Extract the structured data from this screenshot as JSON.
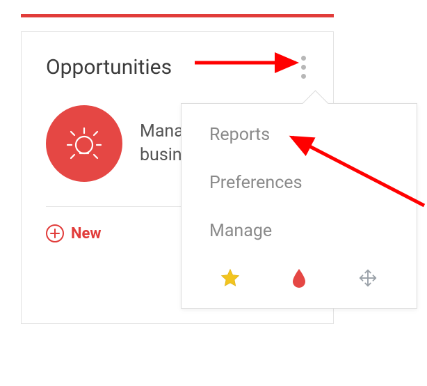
{
  "card": {
    "title": "Opportunities",
    "description": "Manage your business's sales",
    "new_label": "New"
  },
  "menu": {
    "items": [
      {
        "label": "Reports"
      },
      {
        "label": "Preferences"
      },
      {
        "label": "Manage"
      }
    ]
  },
  "colors": {
    "accent": "#e13c3a",
    "star": "#f2c41f",
    "muted": "#9aa1a8"
  }
}
